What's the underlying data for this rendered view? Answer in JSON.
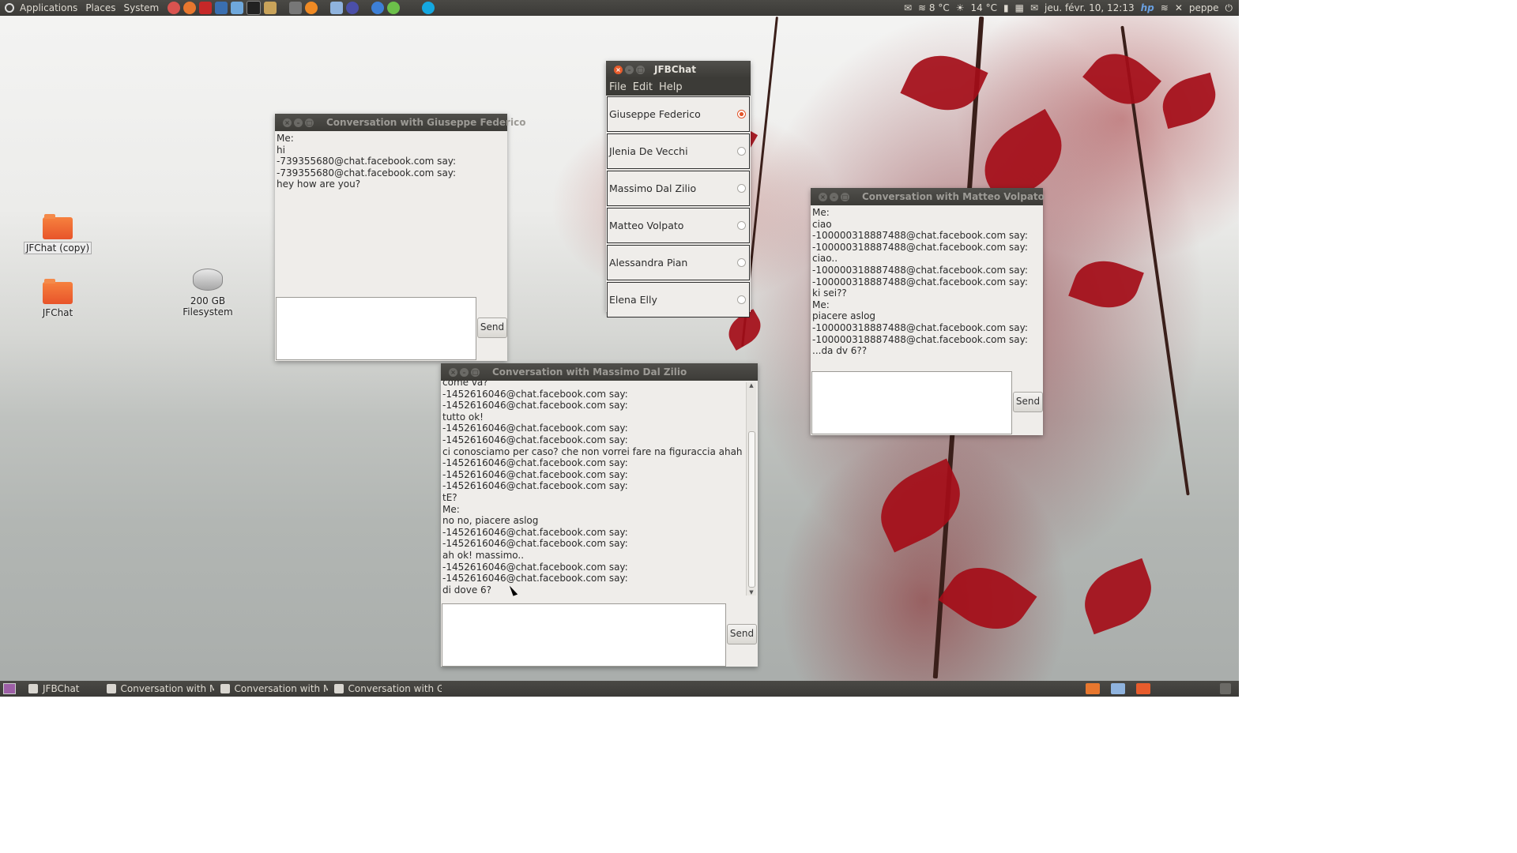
{
  "top_panel": {
    "menus": [
      "Applications",
      "Places",
      "System"
    ],
    "weather1": "≋ 8 °C",
    "weather2": "14 °C",
    "clock": "jeu. févr. 10, 12:13",
    "user": "peppe"
  },
  "desktop": {
    "icons": [
      {
        "label": "JFChat (copy)"
      },
      {
        "label": "JFChat"
      },
      {
        "label": "200 GB Filesystem"
      }
    ]
  },
  "main_window": {
    "title": "JFBChat",
    "menu": [
      "File",
      "Edit",
      "Help"
    ],
    "contacts": [
      {
        "name": "Giuseppe Federico",
        "selected": true
      },
      {
        "name": "Jlenia De Vecchi",
        "selected": false
      },
      {
        "name": "Massimo Dal Zilio",
        "selected": false
      },
      {
        "name": "Matteo Volpato",
        "selected": false
      },
      {
        "name": "Alessandra Pian",
        "selected": false
      },
      {
        "name": "Elena Elly",
        "selected": false
      }
    ]
  },
  "conv_giuseppe": {
    "title": "Conversation with Giuseppe Federico",
    "lines": [
      "Me:",
      "hi",
      "-739355680@chat.facebook.com say:",
      "-739355680@chat.facebook.com say:",
      "hey how are you?"
    ],
    "send": "Send"
  },
  "conv_matteo": {
    "title": "Conversation with Matteo Volpato",
    "lines": [
      "Me:",
      "ciao",
      "-100000318887488@chat.facebook.com say:",
      "-100000318887488@chat.facebook.com say:",
      "ciao..",
      "-100000318887488@chat.facebook.com say:",
      "-100000318887488@chat.facebook.com say:",
      "ki sei??",
      "Me:",
      "piacere aslog",
      "-100000318887488@chat.facebook.com say:",
      "-100000318887488@chat.facebook.com say:",
      "...da dv 6??"
    ],
    "send": "Send"
  },
  "conv_massimo": {
    "title": "Conversation with Massimo Dal Zilio",
    "lines": [
      "come va?",
      "-1452616046@chat.facebook.com say:",
      "-1452616046@chat.facebook.com say:",
      "tutto ok!",
      "-1452616046@chat.facebook.com say:",
      "-1452616046@chat.facebook.com say:",
      "ci conosciamo per caso? che non vorrei fare na figuraccia ahah",
      "-1452616046@chat.facebook.com say:",
      "-1452616046@chat.facebook.com say:",
      "-1452616046@chat.facebook.com say:",
      "tE?",
      "Me:",
      "no no, piacere aslog",
      "-1452616046@chat.facebook.com say:",
      "-1452616046@chat.facebook.com say:",
      "ah ok! massimo..",
      "-1452616046@chat.facebook.com say:",
      "-1452616046@chat.facebook.com say:",
      "di dove 6?"
    ],
    "send": "Send"
  },
  "taskbar": {
    "tasks": [
      "JFBChat",
      "Conversation with M...",
      "Conversation with M...",
      "Conversation with Gi..."
    ]
  },
  "colors": {
    "accent": "#e2562b",
    "panel": "#3c3b37"
  }
}
